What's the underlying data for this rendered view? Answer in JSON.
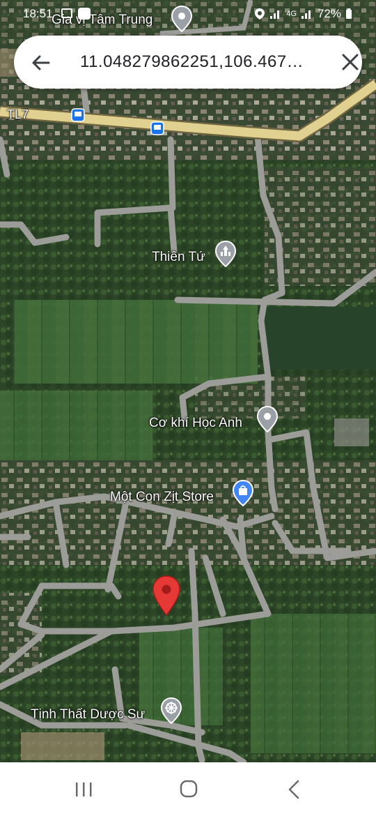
{
  "status_bar": {
    "time": "18:51",
    "network_label": "4G",
    "battery": "72%"
  },
  "search": {
    "query": "11.048279862251,106.467…",
    "back_icon": "arrow-left-icon",
    "close_icon": "close-icon"
  },
  "map": {
    "road_label": "TL7",
    "places": [
      {
        "name": "Gia vị Tâm Trung",
        "icon": "map-pin-icon"
      },
      {
        "name": "Thiên Tứ",
        "icon": "temple-icon"
      },
      {
        "name": "Cơ khí Học Anh",
        "icon": "map-pin-icon"
      },
      {
        "name": "Một Con Zịt Store",
        "icon": "shopping-bag-icon"
      },
      {
        "name": "Tịnh Thất Dược Sư",
        "icon": "dharma-wheel-icon"
      }
    ],
    "marker_icon": "dropped-pin-icon",
    "colors": {
      "marker": "#e53935",
      "poi_gray": "#9aa0a6",
      "shop_blue": "#4285f4",
      "road_major": "#d8c88e"
    }
  },
  "navigation_bar": {
    "recents_icon": "recent-apps-icon",
    "home_icon": "home-icon",
    "back_icon": "back-chevron-icon"
  }
}
